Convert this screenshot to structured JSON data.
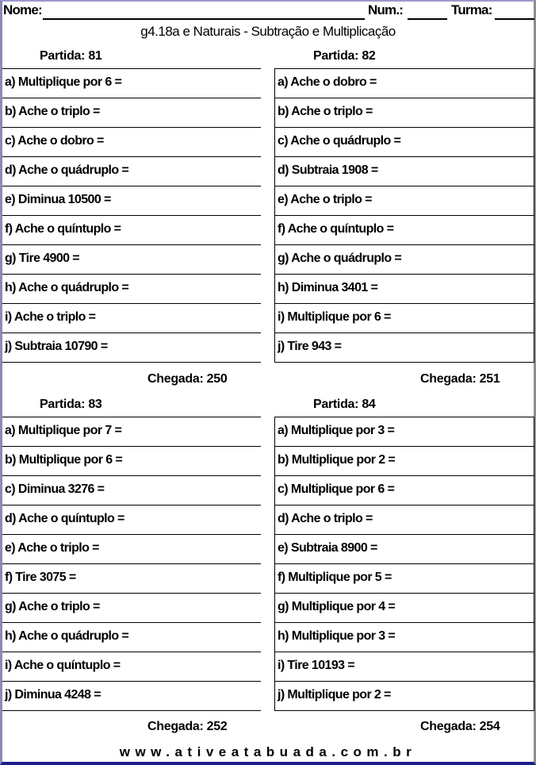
{
  "header": {
    "name_label": "Nome:",
    "num_label": "Num.:",
    "turma_label": "Turma:"
  },
  "title": "g4.18a e Naturais - Subtração e Multiplicação",
  "blocks": [
    {
      "partida_label": "Partida: 81",
      "items": [
        "a) Multiplique por 6 =",
        "b) Ache o triplo  =",
        "c) Ache o dobro  =",
        "d) Ache o quádruplo  =",
        "e) Diminua 10500 =",
        "f) Ache o quíntuplo  =",
        "g) Tire 4900 =",
        "h) Ache o quádruplo  =",
        "i) Ache o triplo  =",
        "j) Subtraia 10790 ="
      ],
      "chegada_label": "Chegada: 250"
    },
    {
      "partida_label": "Partida: 82",
      "items": [
        "a) Ache o dobro  =",
        "b) Ache o triplo  =",
        "c) Ache o quádruplo  =",
        "d) Subtraia 1908 =",
        "e) Ache o triplo  =",
        "f) Ache o quíntuplo  =",
        "g) Ache o quádruplo  =",
        "h) Diminua 3401 =",
        "i) Multiplique por 6 =",
        "j) Tire 943 ="
      ],
      "chegada_label": "Chegada: 251"
    },
    {
      "partida_label": "Partida: 83",
      "items": [
        "a) Multiplique por 7 =",
        "b) Multiplique por 6 =",
        "c) Diminua 3276 =",
        "d) Ache o quíntuplo  =",
        "e) Ache o triplo  =",
        "f) Tire 3075 =",
        "g) Ache o triplo  =",
        "h) Ache o quádruplo  =",
        "i) Ache o quíntuplo  =",
        "j) Diminua 4248 ="
      ],
      "chegada_label": "Chegada: 252"
    },
    {
      "partida_label": "Partida: 84",
      "items": [
        "a) Multiplique por 3 =",
        "b) Multiplique por 2 =",
        "c) Multiplique por 6 =",
        "d) Ache o triplo  =",
        "e) Subtraia 8900 =",
        "f) Multiplique por 5 =",
        "g) Multiplique por 4 =",
        "h) Multiplique por 3 =",
        "i) Tire 10193 =",
        "j) Multiplique por 2 ="
      ],
      "chegada_label": "Chegada: 254"
    }
  ],
  "footer": "www.ativeatabuada.com.br"
}
